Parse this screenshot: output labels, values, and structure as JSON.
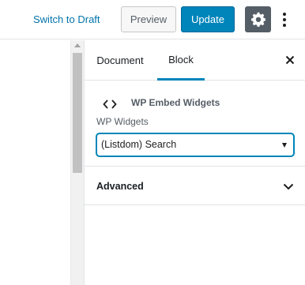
{
  "toolbar": {
    "switch_to_draft": "Switch to Draft",
    "preview": "Preview",
    "update": "Update",
    "settings_icon": "gear-icon",
    "more_icon": "vertical-ellipsis-icon"
  },
  "sidebar": {
    "tabs": [
      {
        "label": "Document"
      },
      {
        "label": "Block",
        "active": true
      }
    ],
    "close_icon": "close-icon",
    "block": {
      "icon": "code-icon",
      "title": "WP Embed Widgets",
      "field_label": "WP Widgets",
      "selected_widget": "(Listdom) Search"
    },
    "panels": [
      {
        "label": "Advanced",
        "expanded": false,
        "icon": "chevron-down-icon"
      }
    ]
  },
  "colors": {
    "accent": "#0085ba",
    "link": "#0073aa",
    "settings_bg": "#555d66"
  }
}
